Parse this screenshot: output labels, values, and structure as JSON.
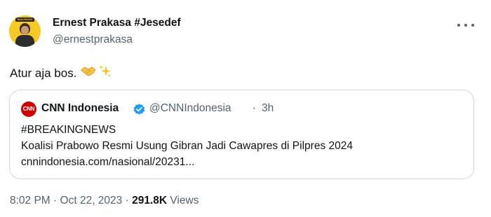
{
  "author": {
    "display_name": "Ernest Prakasa #Jesedef",
    "handle": "@ernestprakasa",
    "avatar_badge": "IMAJINARI"
  },
  "tweet": {
    "text": "Atur aja bos.",
    "emojis": [
      "handshake-icon",
      "sparkles-icon"
    ]
  },
  "quote": {
    "logo_text": "CNN",
    "name": "CNN Indonesia",
    "verified": true,
    "handle": "@CNNIndonesia",
    "separator": "·",
    "time": "3h",
    "lines": [
      "#BREAKINGNEWS",
      "Koalisi Prabowo Resmi Usung Gibran Jadi Cawapres di Pilpres 2024",
      "cnnindonesia.com/nasional/20231..."
    ]
  },
  "meta": {
    "time": "8:02 PM",
    "separator": "·",
    "date": "Oct 22, 2023",
    "views_count": "291.8K",
    "views_label": "Views"
  },
  "colors": {
    "text_primary": "#0f1419",
    "text_secondary": "#536471",
    "border": "#cfd9de",
    "verified": "#1d9bf0",
    "cnn_red": "#cc0000"
  }
}
